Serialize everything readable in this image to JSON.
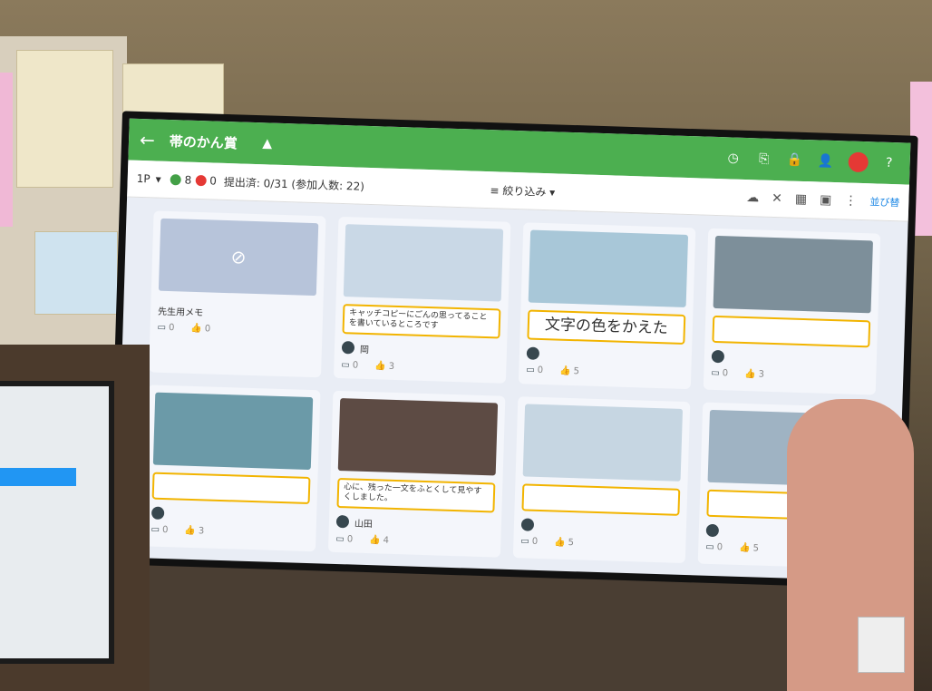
{
  "app": {
    "title": "帯のかん賞",
    "back_icon": "back-arrow-icon"
  },
  "toolbar": {
    "page": "1P",
    "green_count": "8",
    "red_count": "0",
    "submitted": "提出済: 0/31 (参加人数: 22)",
    "filter_label": "絞り込み",
    "right_label": "並び替"
  },
  "cards": [
    {
      "type": "memo",
      "memo": "先生用メモ",
      "comments": "0",
      "likes": "0"
    },
    {
      "caption": "キャッチコピーにごんの思ってることを書いているところです",
      "author": "岡",
      "comments": "0",
      "likes": "3"
    },
    {
      "caption": "文字の色をかえた",
      "author": "",
      "comments": "0",
      "likes": "5"
    },
    {
      "caption": "",
      "author": "",
      "comments": "0",
      "likes": "3"
    },
    {
      "caption": "",
      "author": "",
      "comments": "0",
      "likes": "3"
    },
    {
      "caption": "心に、残った一文をふとくして見やすくしました。",
      "author": "山田",
      "comments": "0",
      "likes": "4"
    },
    {
      "caption": "",
      "author": "",
      "comments": "0",
      "likes": "5"
    },
    {
      "caption": "",
      "author": "",
      "comments": "0",
      "likes": "5"
    }
  ]
}
